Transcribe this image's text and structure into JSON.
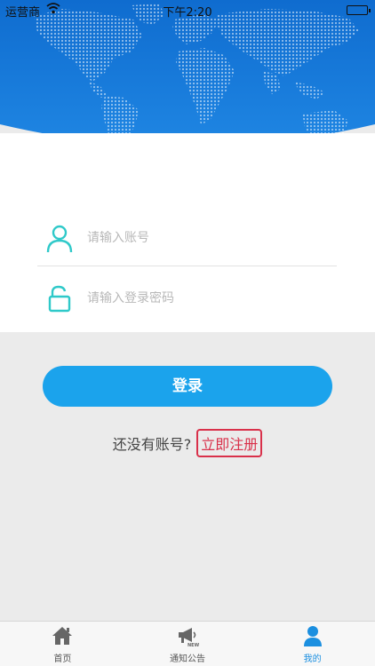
{
  "status_bar": {
    "carrier": "运营商",
    "time": "下午2:20"
  },
  "login": {
    "account_placeholder": "请输入账号",
    "password_placeholder": "请输入登录密码",
    "login_label": "登录",
    "register_prompt": "还没有账号?",
    "register_link": "立即注册"
  },
  "tabs": [
    {
      "label": "首页",
      "icon": "home-icon"
    },
    {
      "label": "通知公告",
      "icon": "megaphone-new-icon"
    },
    {
      "label": "我的",
      "icon": "user-icon"
    }
  ],
  "colors": {
    "header_blue": "#1a73d2",
    "button_blue": "#1ba3ec",
    "icon_teal": "#2fc9c9",
    "register_red": "#d9304a",
    "active_tab": "#1b8fe0"
  }
}
